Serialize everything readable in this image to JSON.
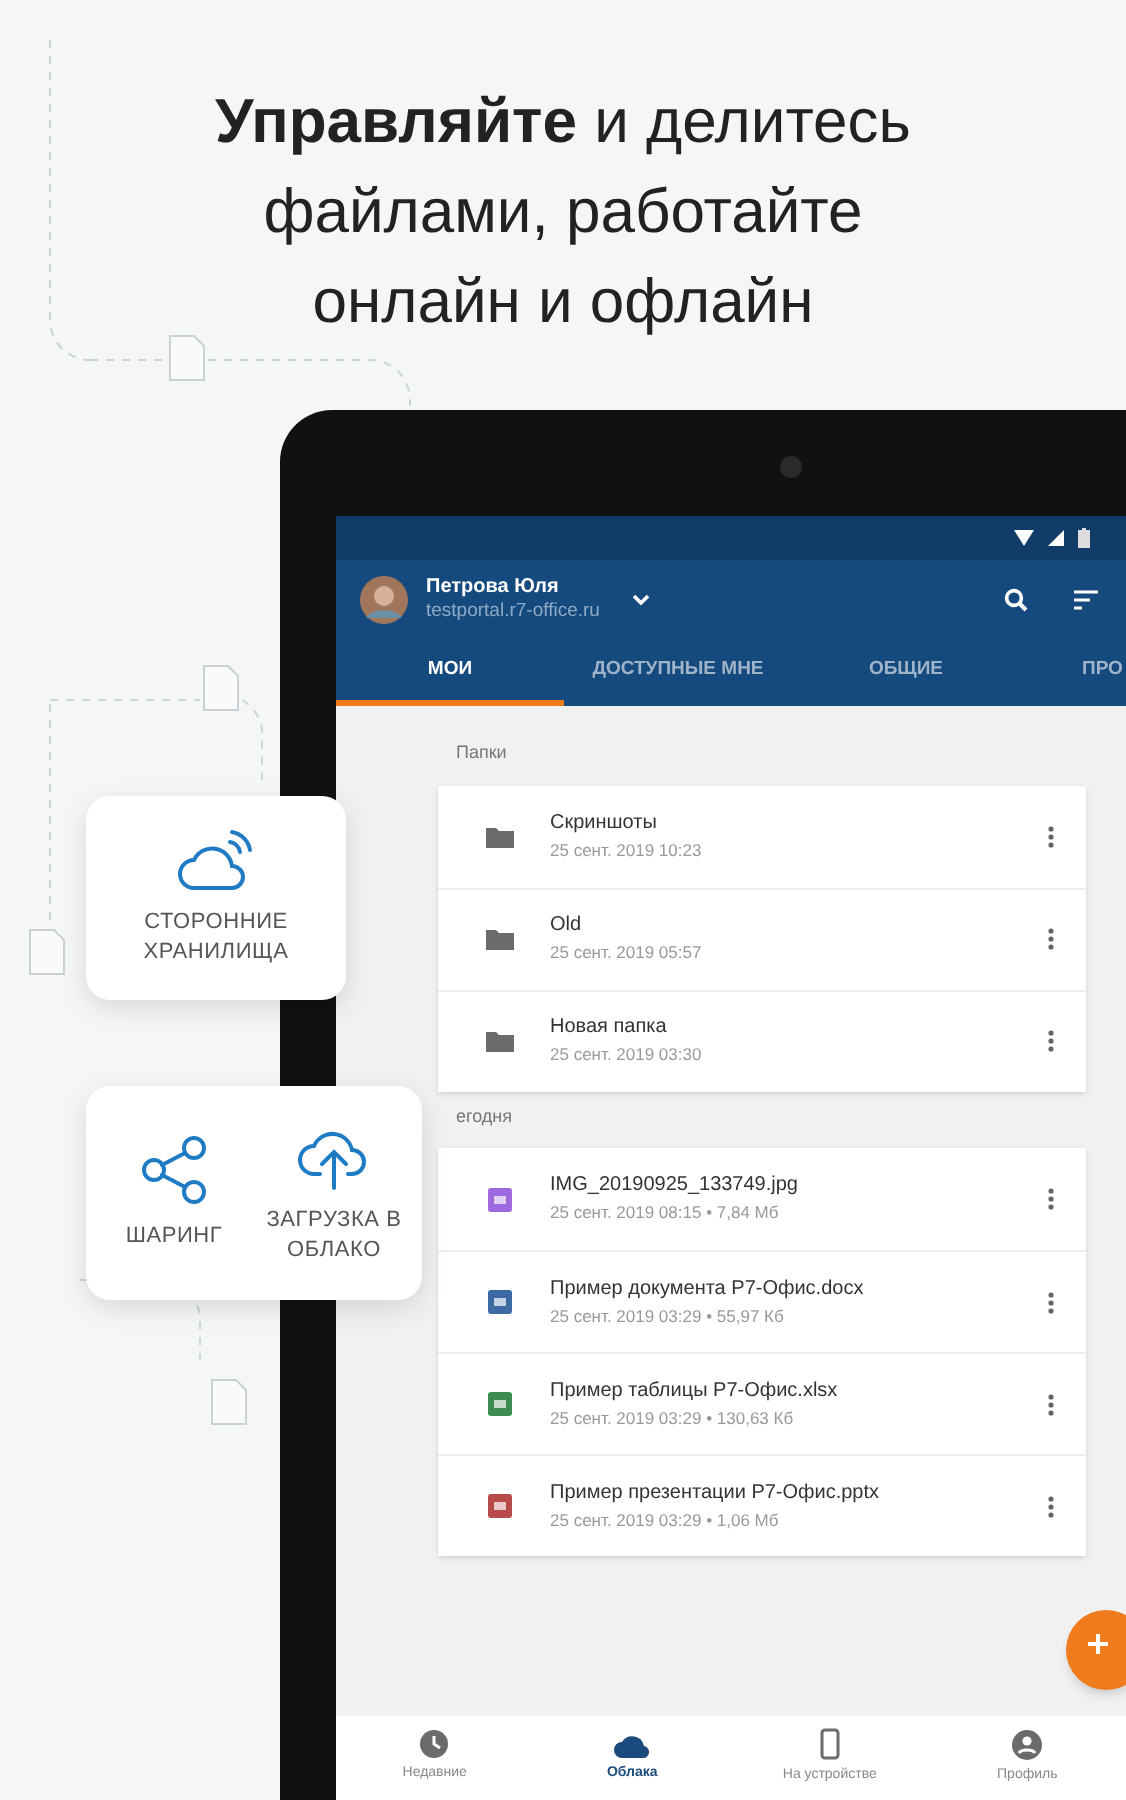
{
  "headline_lines": [
    "**Управляйте** и делитесь",
    "файлами, работайте",
    "онлайн и офлайн"
  ],
  "account": {
    "name": "Петрова Юля",
    "portal": "testportal.r7-office.ru"
  },
  "tabs": [
    {
      "label": "МОИ",
      "selected": true
    },
    {
      "label": "ДОСТУПНЫЕ МНЕ",
      "selected": false
    },
    {
      "label": "ОБЩИЕ",
      "selected": false
    },
    {
      "label": "ПРО",
      "selected": false
    }
  ],
  "sections": [
    {
      "title": "Папки",
      "items": [
        {
          "kind": "folder",
          "name": "Скриншоты",
          "meta": "25 сент. 2019 10:23"
        },
        {
          "kind": "folder",
          "name": "Old",
          "meta": "25 сент. 2019 05:57"
        },
        {
          "kind": "folder",
          "name": "Новая папка",
          "meta": "25 сент. 2019 03:30"
        }
      ]
    },
    {
      "title": "егодня",
      "items": [
        {
          "kind": "image",
          "name": "IMG_20190925_133749.jpg",
          "meta": "25 сент. 2019 08:15 • 7,84 Мб"
        },
        {
          "kind": "document",
          "name": "Пример документа Р7-Офис.docx",
          "meta": "25 сент. 2019 03:29 • 55,97 Кб"
        },
        {
          "kind": "spreadsheet",
          "name": "Пример таблицы Р7-Офис.xlsx",
          "meta": "25 сент. 2019 03:29 • 130,63 Кб"
        },
        {
          "kind": "presentation",
          "name": "Пример презентации Р7-Офис.pptx",
          "meta": "25 сент. 2019 03:29 • 1,06 Мб"
        }
      ]
    }
  ],
  "bottom_nav": [
    {
      "kind": "recent",
      "label": "Недавние",
      "selected": false
    },
    {
      "kind": "cloud",
      "label": "Облака",
      "selected": true
    },
    {
      "kind": "device",
      "label": "На устройстве",
      "selected": false
    },
    {
      "kind": "profile",
      "label": "Профиль",
      "selected": false
    }
  ],
  "feature_cards": [
    {
      "features": [
        {
          "kind": "storage",
          "label": "СТОРОННИЕ ХРАНИЛИЩА"
        }
      ]
    },
    {
      "features": [
        {
          "kind": "share",
          "label": "ШАРИНГ"
        },
        {
          "kind": "upload",
          "label": "ЗАГРУЗКА В ОБЛАКО"
        }
      ]
    }
  ]
}
